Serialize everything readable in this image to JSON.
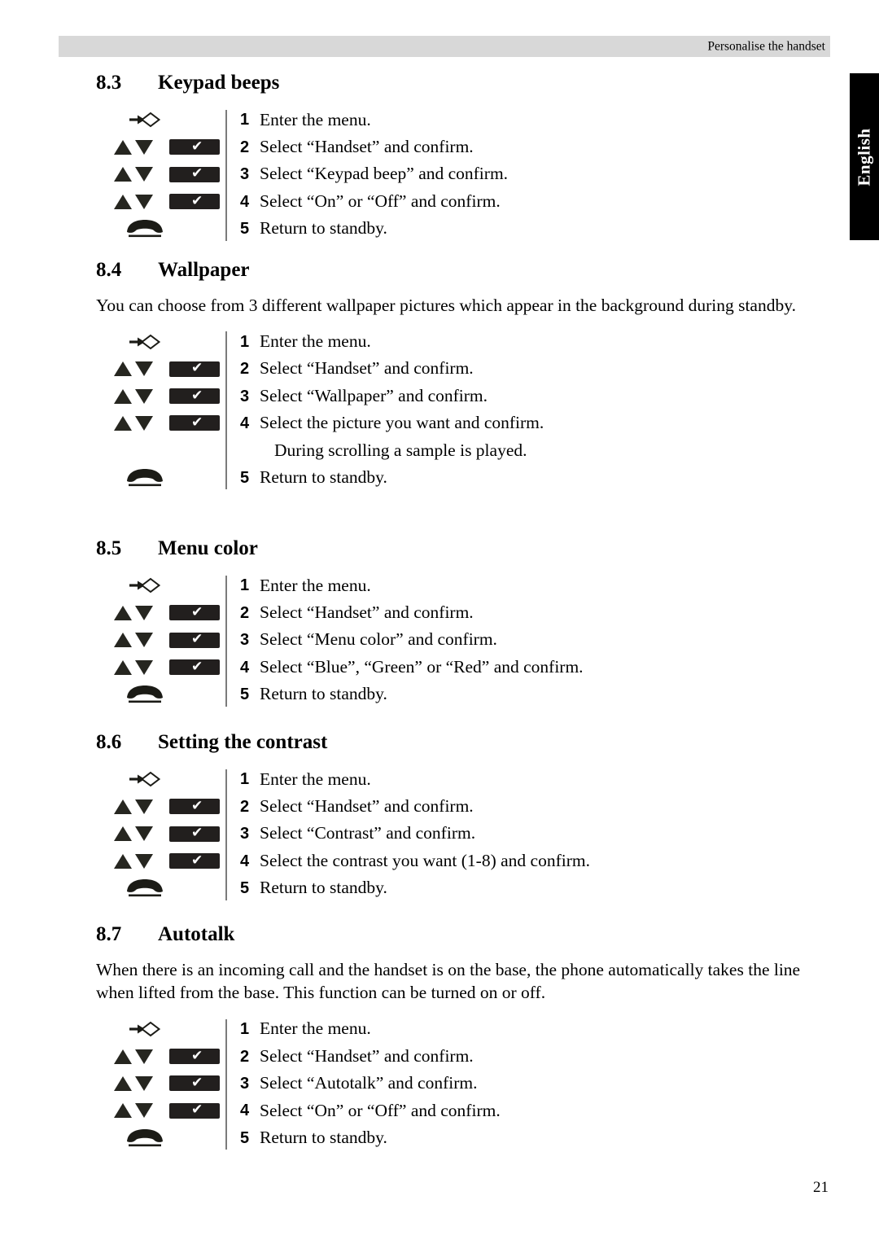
{
  "header": {
    "running_head": "Personalise the handset"
  },
  "thumb_tab": {
    "label": "English"
  },
  "footer": {
    "page_number": "21"
  },
  "icons": {
    "menu": "menu-enter-icon",
    "scroll": "up-down-arrows-icon",
    "confirm": "confirm-softkey-icon",
    "hangup": "hangup-handset-icon"
  },
  "sections": [
    {
      "number": "8.3",
      "title": "Keypad beeps",
      "intro": null,
      "steps": [
        {
          "key": "menu",
          "num": "1",
          "text": "Enter the menu."
        },
        {
          "key": "scroll-ok",
          "num": "2",
          "text": "Select “Handset” and confirm."
        },
        {
          "key": "scroll-ok",
          "num": "3",
          "text": "Select “Keypad beep” and confirm."
        },
        {
          "key": "scroll-ok",
          "num": "4",
          "text": "Select “On” or “Off” and confirm."
        },
        {
          "key": "hangup",
          "num": "5",
          "text": "Return to standby."
        }
      ]
    },
    {
      "number": "8.4",
      "title": "Wallpaper",
      "intro": "You can choose from 3 different wallpaper pictures which appear in the background during standby.",
      "steps": [
        {
          "key": "menu",
          "num": "1",
          "text": "Enter the menu."
        },
        {
          "key": "scroll-ok",
          "num": "2",
          "text": "Select “Handset” and confirm."
        },
        {
          "key": "scroll-ok",
          "num": "3",
          "text": "Select “Wallpaper” and confirm."
        },
        {
          "key": "scroll-ok",
          "num": "4",
          "text": "Select the picture you want and confirm."
        },
        {
          "key": "none",
          "num": "",
          "text": "During scrolling a sample is played."
        },
        {
          "key": "hangup",
          "num": "5",
          "text": "Return to standby."
        }
      ]
    },
    {
      "number": "8.5",
      "title": "Menu color",
      "intro": null,
      "steps": [
        {
          "key": "menu",
          "num": "1",
          "text": "Enter the menu."
        },
        {
          "key": "scroll-ok",
          "num": "2",
          "text": "Select “Handset” and confirm."
        },
        {
          "key": "scroll-ok",
          "num": "3",
          "text": "Select “Menu color” and confirm."
        },
        {
          "key": "scroll-ok",
          "num": "4",
          "text": "Select “Blue”, “Green” or “Red” and confirm."
        },
        {
          "key": "hangup",
          "num": "5",
          "text": "Return to standby."
        }
      ]
    },
    {
      "number": "8.6",
      "title": "Setting the contrast",
      "intro": null,
      "steps": [
        {
          "key": "menu",
          "num": "1",
          "text": "Enter the menu."
        },
        {
          "key": "scroll-ok",
          "num": "2",
          "text": "Select “Handset” and confirm."
        },
        {
          "key": "scroll-ok",
          "num": "3",
          "text": "Select “Contrast” and confirm."
        },
        {
          "key": "scroll-ok",
          "num": "4",
          "text": "Select the contrast you want (1-8) and confirm."
        },
        {
          "key": "hangup",
          "num": "5",
          "text": "Return to standby."
        }
      ]
    },
    {
      "number": "8.7",
      "title": "Autotalk",
      "intro": "When there is an incoming call and the handset is on the base, the phone automatically takes the line when lifted from the base. This function can be turned on or off.",
      "steps": [
        {
          "key": "menu",
          "num": "1",
          "text": "Enter the menu."
        },
        {
          "key": "scroll-ok",
          "num": "2",
          "text": "Select “Handset” and confirm."
        },
        {
          "key": "scroll-ok",
          "num": "3",
          "text": "Select “Autotalk” and confirm."
        },
        {
          "key": "scroll-ok",
          "num": "4",
          "text": "Select “On” or “Off” and confirm."
        },
        {
          "key": "hangup",
          "num": "5",
          "text": "Return to standby."
        }
      ]
    }
  ],
  "layout": {
    "section_tops": [
      88,
      318,
      660,
      898,
      1134
    ]
  }
}
